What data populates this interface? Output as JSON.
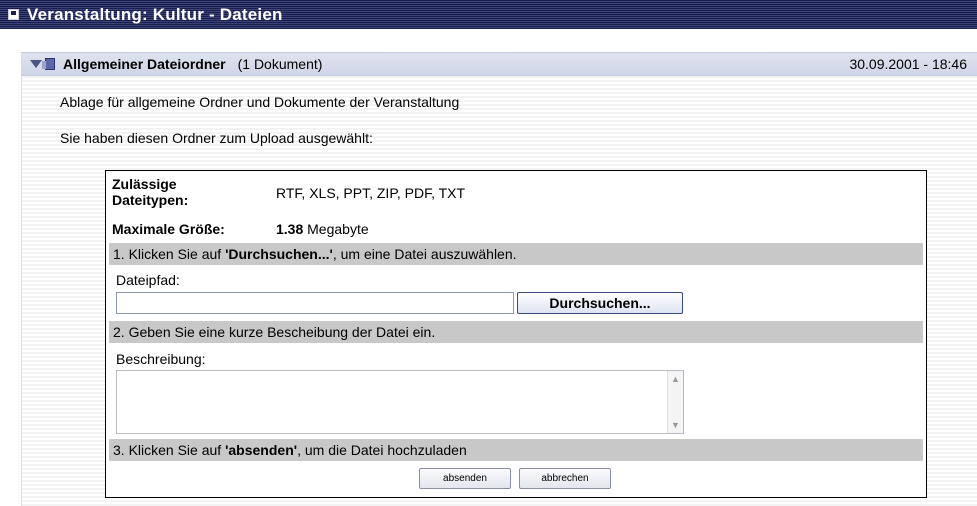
{
  "window": {
    "title": "Veranstaltung: Kultur - Dateien"
  },
  "folder": {
    "title": "Allgemeiner Dateiordner",
    "count": "(1 Dokument)",
    "date": "30.09.2001 - 18:46",
    "description": "Ablage für allgemeine Ordner und Dokumente der Veranstaltung",
    "upload_notice": "Sie haben diesen Ordner zum Upload ausgewählt:"
  },
  "upload": {
    "types_label_line1": "Zulässige",
    "types_label_line2": "Dateitypen:",
    "types_value": "RTF, XLS, PPT, ZIP, PDF, TXT",
    "max_label": "Maximale Größe:",
    "max_value": "1.38",
    "max_unit": "Megabyte",
    "step1_prefix": "1. Klicken Sie auf ",
    "step1_bold": "'Durchsuchen...'",
    "step1_suffix": ", um eine Datei auszuwählen.",
    "path_label": "Dateipfad:",
    "path_value": "",
    "browse_label": "Durchsuchen...",
    "step2": "2. Geben Sie eine kurze Bescheibung der Datei ein.",
    "desc_label": "Beschreibung:",
    "desc_value": "",
    "step3_prefix": "3. Klicken Sie auf ",
    "step3_bold": "'absenden'",
    "step3_suffix": ", um die Datei hochzuladen",
    "submit_label": "absenden",
    "cancel_label": "abbrechen"
  },
  "icons": {
    "window": "window-icon",
    "collapse": "collapse-triangle-icon",
    "folder": "folder-icon",
    "scroll_up": "scroll-up-arrow-icon",
    "scroll_down": "scroll-down-arrow-icon"
  },
  "colors": {
    "titlebar": "#1a1f4e",
    "folderbar": "#cfd5e8",
    "stepbar": "#c8c8c8"
  }
}
